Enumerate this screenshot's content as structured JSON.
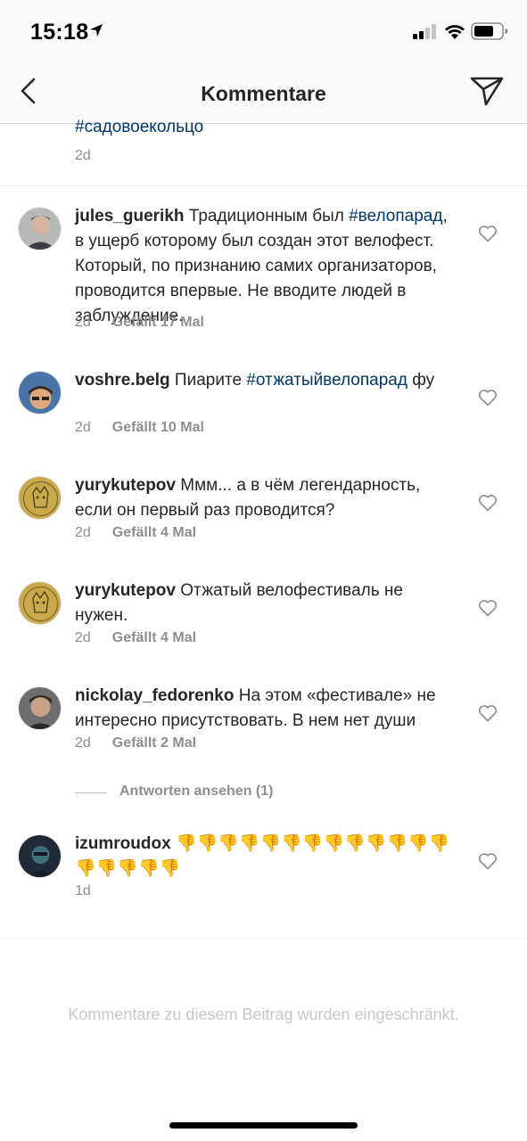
{
  "status_bar": {
    "time": "15:18"
  },
  "header": {
    "title": "Kommentare"
  },
  "caption": {
    "hashtag": "#садовоекольцо",
    "age": "2d"
  },
  "comments": [
    {
      "username": "jules_guerikh",
      "pre": " Традиционным был ",
      "tag": "#велопарад",
      "post": ", в ущерб которому был создан этот велофест. Который, по признанию самих организаторов, проводится впервые. Не вводите людей в заблуждение.",
      "age": "2d",
      "likes": "Gefällt 17 Mal"
    },
    {
      "username": "voshre.belg",
      "pre": " Пиарите ",
      "tag": "#отжатыйвелопарад",
      "post": " фу",
      "age": "2d",
      "likes": "Gefällt 10 Mal"
    },
    {
      "username": "yurykutepov",
      "pre": " Ммм... а в чём легендарность, если он первый раз проводится?",
      "tag": "",
      "post": "",
      "age": "2d",
      "likes": "Gefällt 4 Mal"
    },
    {
      "username": "yurykutepov",
      "pre": " Отжатый велофестиваль не нужен.",
      "tag": "",
      "post": "",
      "age": "2d",
      "likes": "Gefällt 4 Mal"
    },
    {
      "username": "nickolay_fedorenko",
      "pre": " На этом «фестивале» не интересно присутствовать. В нем нет души",
      "tag": "",
      "post": "",
      "age": "2d",
      "likes": "Gefällt 2 Mal"
    },
    {
      "username": "izumroudox",
      "pre": " 👎👎👎👎👎👎👎👎👎👎👎👎👎👎👎👎👎👎",
      "tag": "",
      "post": "",
      "age": "1d",
      "likes": ""
    }
  ],
  "view_replies": "Antworten ansehen (1)",
  "footer": {
    "restricted_text": "Kommentare zu diesem Beitrag wurden eingeschränkt."
  },
  "colors": {
    "hashtag": "#00376b",
    "meta": "#8e8e8e",
    "text": "#262626",
    "restricted": "#c7c7c7"
  }
}
